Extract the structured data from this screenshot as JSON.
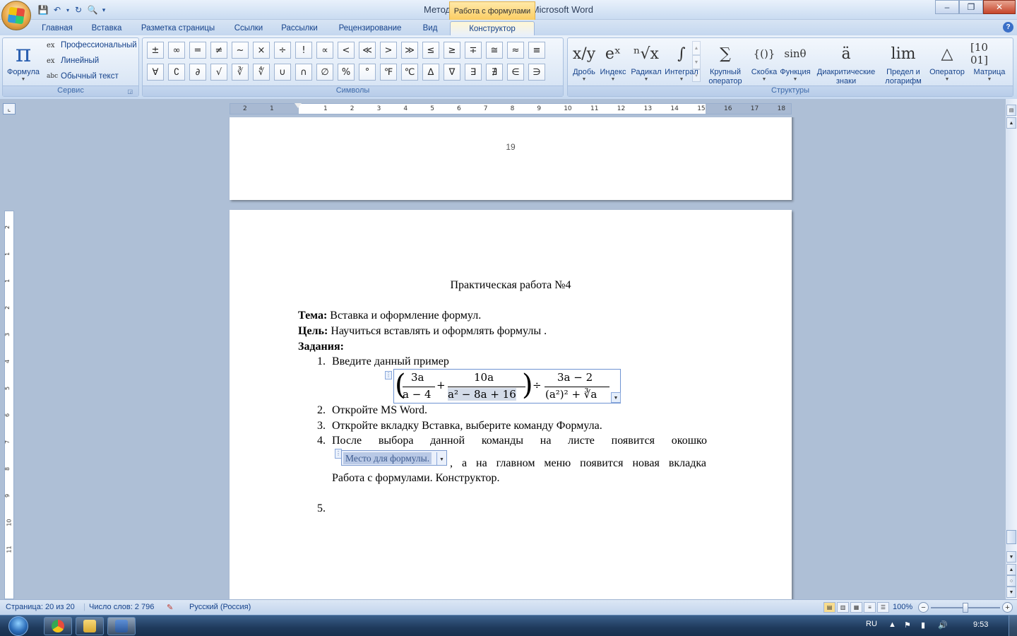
{
  "window": {
    "doc_title": "Методичка WORD.docx - Microsoft Word",
    "tools_title": "Работа с формулами",
    "min_icon": "–",
    "restore_icon": "❐",
    "close_icon": "✕"
  },
  "qat": {
    "save": "💾",
    "undo": "↶",
    "undo_dd": "▾",
    "redo": "↻",
    "preview": "🔍",
    "customize": "▾"
  },
  "tabs": [
    "Главная",
    "Вставка",
    "Разметка страницы",
    "Ссылки",
    "Рассылки",
    "Рецензирование",
    "Вид",
    "Конструктор"
  ],
  "help": "?",
  "service": {
    "group_label": "Сервис",
    "formula_label": "Формула",
    "formula_icon": "π",
    "professional": "Профессиональный",
    "linear": "Линейный",
    "plain_text": "Обычный текст",
    "plain_icon": "abc",
    "e_icon": "ex"
  },
  "symbols": {
    "group_label": "Символы",
    "row1": [
      "±",
      "∞",
      "=",
      "≠",
      "~",
      "×",
      "÷",
      "!",
      "∝",
      "<",
      "≪",
      ">",
      "≫",
      "≤",
      "≥",
      "∓",
      "≅",
      "≈",
      "≡"
    ],
    "row2": [
      "∀",
      "∁",
      "∂",
      "√",
      "∛",
      "∜",
      "∪",
      "∩",
      "∅",
      "%",
      "°",
      "℉",
      "℃",
      "∆",
      "∇",
      "∃",
      "∄",
      "∈",
      "∋"
    ]
  },
  "structures": {
    "group_label": "Структуры",
    "items": [
      {
        "icon": "x/y",
        "label": "Дробь"
      },
      {
        "icon": "eˣ",
        "label": "Индекс"
      },
      {
        "icon": "ⁿ√x",
        "label": "Радикал"
      },
      {
        "icon": "∫",
        "label": "Интеграл"
      },
      {
        "icon": "∑",
        "label": "Крупный оператор"
      },
      {
        "icon": "{()}",
        "label": "Скобка"
      },
      {
        "icon": "sinθ",
        "label": "Функция"
      },
      {
        "icon": "ä",
        "label": "Диакритические знаки"
      },
      {
        "icon": "lim",
        "label": "Предел и логарифм"
      },
      {
        "icon": "△",
        "label": "Оператор"
      },
      {
        "icon": "[10 01]",
        "label": "Матрица"
      }
    ],
    "labels_split": [
      [
        "Дробь"
      ],
      [
        "Индекс"
      ],
      [
        "Радикал"
      ],
      [
        "Интеграл"
      ],
      [
        "Крупный",
        "оператор"
      ],
      [
        "Скобка"
      ],
      [
        "Функция"
      ],
      [
        "Диакритические",
        "знаки"
      ],
      [
        "Предел и",
        "логарифм"
      ],
      [
        "Оператор"
      ],
      [
        "Матрица"
      ]
    ]
  },
  "ruler": {
    "marks": [
      "2",
      "1",
      "1",
      "2",
      "3",
      "4",
      "5",
      "6",
      "7",
      "8",
      "9",
      "10",
      "11",
      "12",
      "13",
      "14",
      "15",
      "16",
      "17",
      "18"
    ],
    "vmarks": [
      "2",
      "1",
      "1",
      "2",
      "3",
      "4",
      "5",
      "6",
      "7",
      "8",
      "9",
      "10",
      "11"
    ]
  },
  "document": {
    "page_number": "19",
    "title": "Практическая работа №4",
    "tema_label": "Тема:",
    "tema": "Вставка и оформление формул.",
    "cel_label": "Цель:",
    "cel": "Научиться вставлять и оформлять формулы .",
    "zadaniya": "Задания:",
    "items": [
      {
        "num": "1.",
        "text": "Введите данный пример"
      },
      {
        "num": "2.",
        "text": "Откройте MS Word."
      },
      {
        "num": "3.",
        "text": "Откройте вкладку Вставка, выберите команду Формула."
      },
      {
        "num": "4.",
        "text": "После выбора данной команды на листе появится окошко"
      },
      {
        "num": "5.",
        "text": ""
      }
    ],
    "item4_cont": ", а на главном меню появится новая вкладка",
    "item4_cont2": "Работа с формулами. Конструктор.",
    "placeholder": "Место для формулы.",
    "formula": {
      "f1_num": "3a",
      "f1_den": "a − 4",
      "plus": "+",
      "f2_num": "10a",
      "f2_den": "a² − 8a + 16",
      "div": "÷",
      "f3_num": "3a − 2",
      "f3_den": "(a²)² + ∛a"
    }
  },
  "status": {
    "page": "Страница: 20 из 20",
    "words": "Число слов: 2 796",
    "lang": "Русский (Россия)",
    "zoom": "100%"
  },
  "taskbar": {
    "lang": "RU",
    "time": "9:53"
  }
}
